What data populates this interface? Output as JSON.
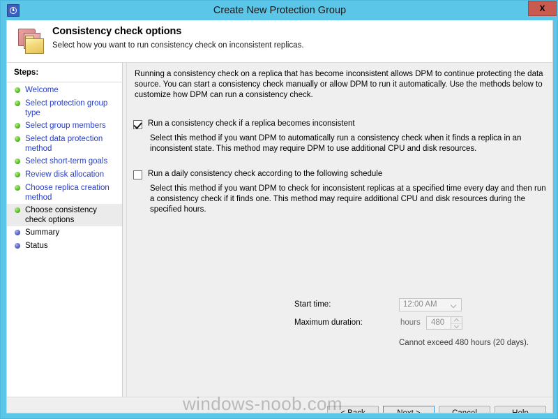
{
  "window": {
    "title": "Create New Protection Group",
    "icon": "clock-history-icon",
    "close_label": "X",
    "frame_color": "#5cc6e8"
  },
  "header": {
    "icon": "protection-group-folders-icon",
    "title": "Consistency check options",
    "subtitle": "Select how you want to run consistency check on inconsistent replicas."
  },
  "sidebar": {
    "label": "Steps:",
    "items": [
      {
        "label": "Welcome",
        "state": "done",
        "current": false
      },
      {
        "label": "Select protection group type",
        "state": "done",
        "current": false
      },
      {
        "label": "Select group members",
        "state": "done",
        "current": false
      },
      {
        "label": "Select data protection method",
        "state": "done",
        "current": false
      },
      {
        "label": "Select short-term goals",
        "state": "done",
        "current": false
      },
      {
        "label": "Review disk allocation",
        "state": "done",
        "current": false
      },
      {
        "label": "Choose replica creation method",
        "state": "done",
        "current": false
      },
      {
        "label": "Choose consistency check options",
        "state": "done",
        "current": true
      },
      {
        "label": "Summary",
        "state": "future",
        "current": false
      },
      {
        "label": "Status",
        "state": "future",
        "current": false
      }
    ]
  },
  "main": {
    "intro": "Running a consistency check on a replica that has become inconsistent allows DPM to continue protecting the data source. You can start a consistency check manually or allow DPM to run it automatically. Use the methods below to customize how DPM can run a consistency check.",
    "option_auto": {
      "label": "Run a consistency check if a replica becomes inconsistent",
      "checked": true,
      "description": "Select this method if you want DPM to automatically run a consistency check when it finds a replica in an inconsistent state. This method may require DPM to use additional CPU and disk resources."
    },
    "option_daily": {
      "label": "Run a daily consistency check according to the following schedule",
      "checked": false,
      "description": "Select this method if you want DPM to check for inconsistent replicas at a specified time every day and then run a consistency check if it finds one. This method may require additional CPU and disk resources during the specified hours."
    },
    "schedule": {
      "start_time_label": "Start time:",
      "start_time_value": "12:00 AM",
      "max_duration_label": "Maximum duration:",
      "hours_label": "hours",
      "max_duration_value": "480",
      "note": "Cannot exceed 480 hours (20 days)."
    }
  },
  "footer": {
    "back": "< Back",
    "next": "Next >",
    "cancel": "Cancel",
    "help": "Help"
  },
  "watermark": "windows-noob.com"
}
